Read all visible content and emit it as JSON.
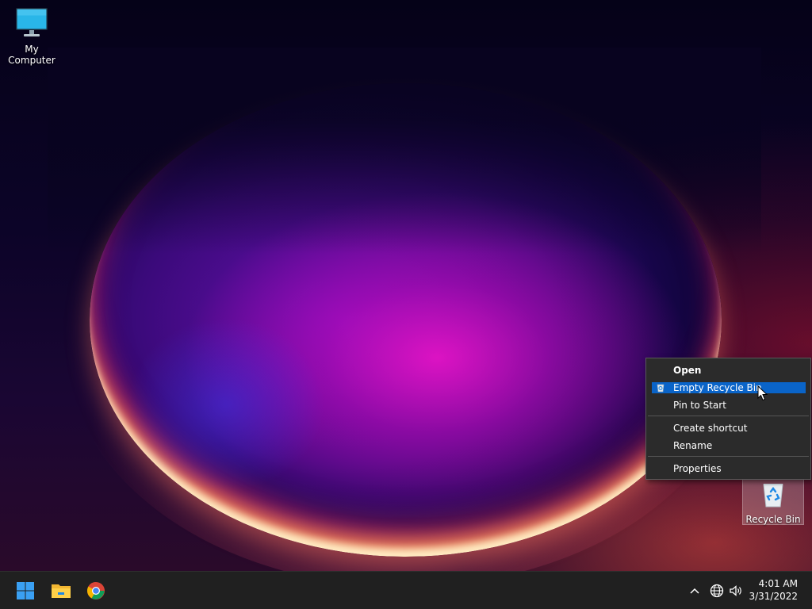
{
  "desktop": {
    "icons": [
      {
        "label": "My Computer",
        "icon": "monitor-icon"
      },
      {
        "label": "Recycle Bin",
        "icon": "recycle-bin-icon",
        "selected": true
      }
    ]
  },
  "context_menu": {
    "items": [
      {
        "label": "Open",
        "bold": true
      },
      {
        "label": "Empty Recycle Bin",
        "highlighted": true,
        "icon": "recycle-bin-small-icon"
      },
      {
        "label": "Pin to Start"
      },
      {
        "label": "Create shortcut"
      },
      {
        "label": "Rename"
      },
      {
        "label": "Properties"
      }
    ],
    "highlight_color": "#0a64c8"
  },
  "taskbar": {
    "pinned": [
      {
        "name": "Start",
        "icon": "windows-start-icon"
      },
      {
        "name": "File Explorer",
        "icon": "folder-icon"
      },
      {
        "name": "Google Chrome",
        "icon": "chrome-icon"
      }
    ],
    "tray": {
      "icons": [
        "chevron-up-icon",
        "network-globe-icon",
        "speaker-icon"
      ],
      "time": "4:01 AM",
      "date": "3/31/2022"
    }
  }
}
